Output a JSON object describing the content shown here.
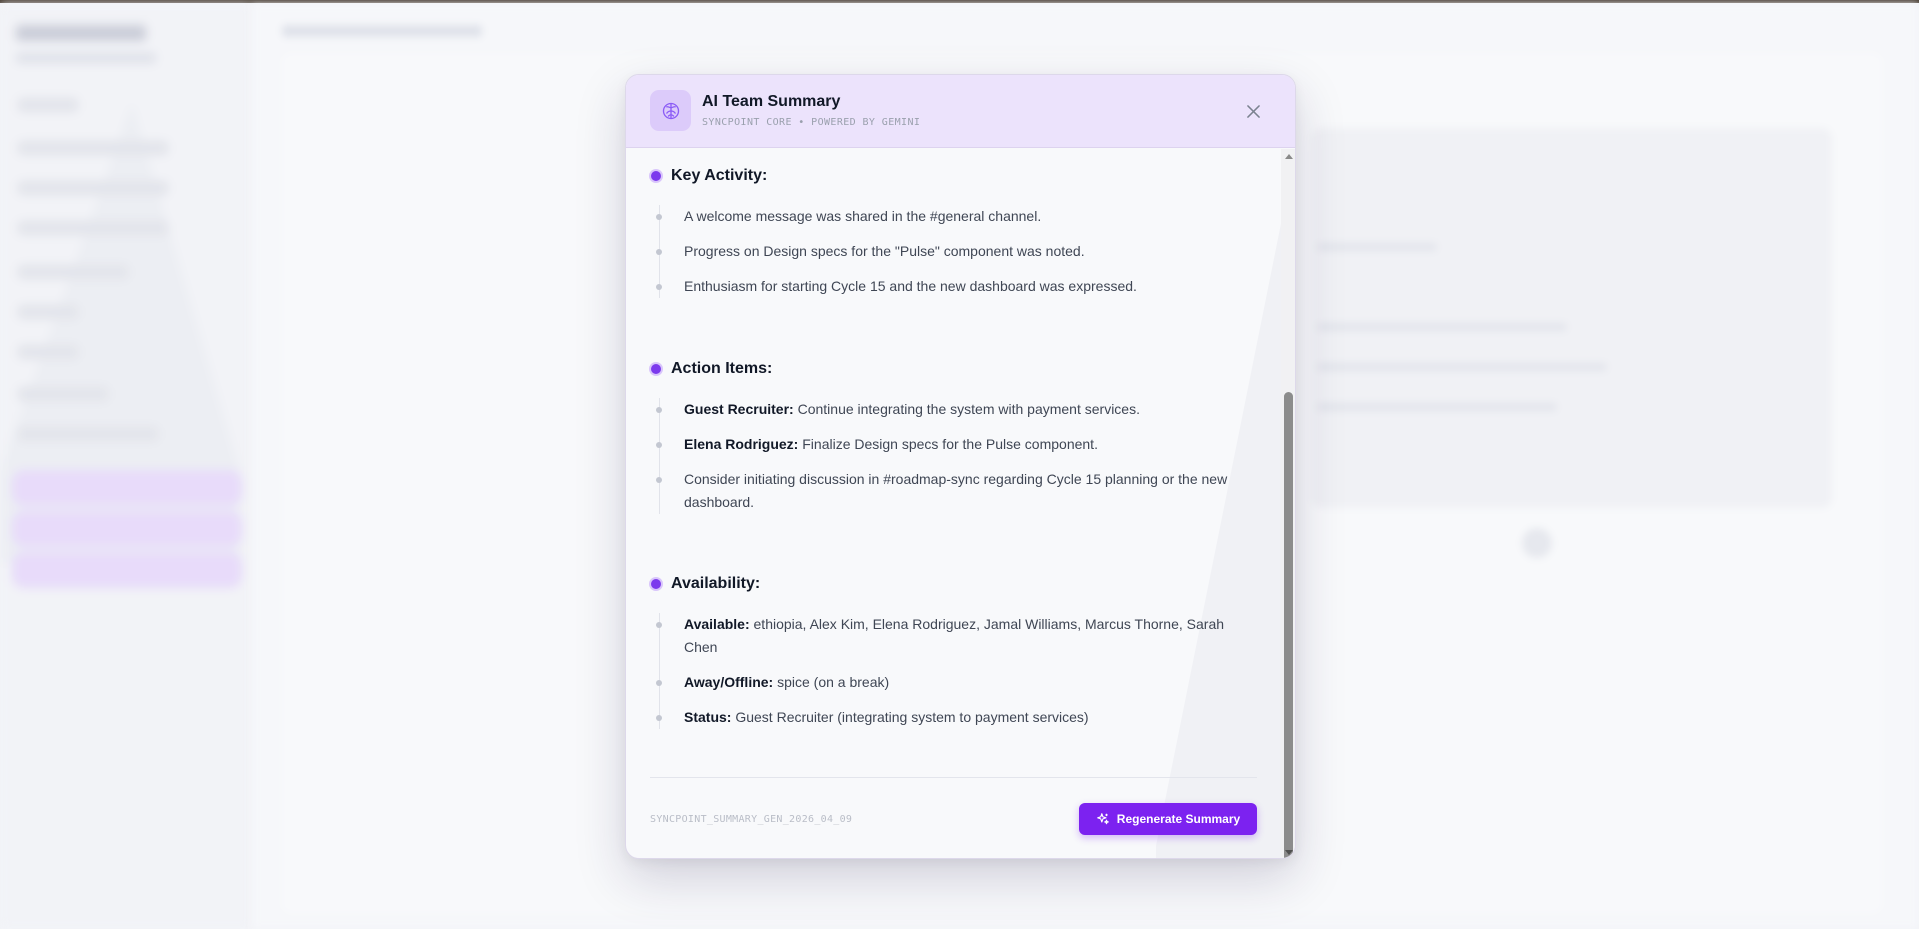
{
  "modal": {
    "title": "AI Team Summary",
    "subtitle": "SYNCPOINT CORE • POWERED BY GEMINI",
    "icon": "brain-icon",
    "close_icon": "close-icon"
  },
  "sections": [
    {
      "title": "Key Activity:",
      "items": [
        {
          "label": "",
          "text": "A welcome message was shared in the #general channel."
        },
        {
          "label": "",
          "text": "Progress on Design specs for the \"Pulse\" component was noted."
        },
        {
          "label": "",
          "text": "Enthusiasm for starting Cycle 15 and the new dashboard was expressed."
        }
      ]
    },
    {
      "title": "Action Items:",
      "items": [
        {
          "label": "Guest Recruiter:",
          "text": "Continue integrating the system with payment services."
        },
        {
          "label": "Elena Rodriguez:",
          "text": "Finalize Design specs for the Pulse component."
        },
        {
          "label": "",
          "text": "Consider initiating discussion in #roadmap-sync regarding Cycle 15 planning or the new dashboard."
        }
      ]
    },
    {
      "title": "Availability:",
      "items": [
        {
          "label": "Available:",
          "text": "ethiopia, Alex Kim, Elena Rodriguez, Jamal Williams, Marcus Thorne, Sarah Chen"
        },
        {
          "label": "Away/Offline:",
          "text": "spice (on a break)"
        },
        {
          "label": "Status:",
          "text": "Guest Recruiter (integrating system to payment services)"
        }
      ]
    }
  ],
  "footer": {
    "id": "SYNCPOINT_SUMMARY_GEN_2026_04_09",
    "regenerate_label": "Regenerate Summary",
    "regenerate_icon": "sparkles-icon"
  },
  "colors": {
    "accent": "#7c22f0",
    "header_bg": "#ece3fc",
    "bullet": "#7c3aed"
  }
}
